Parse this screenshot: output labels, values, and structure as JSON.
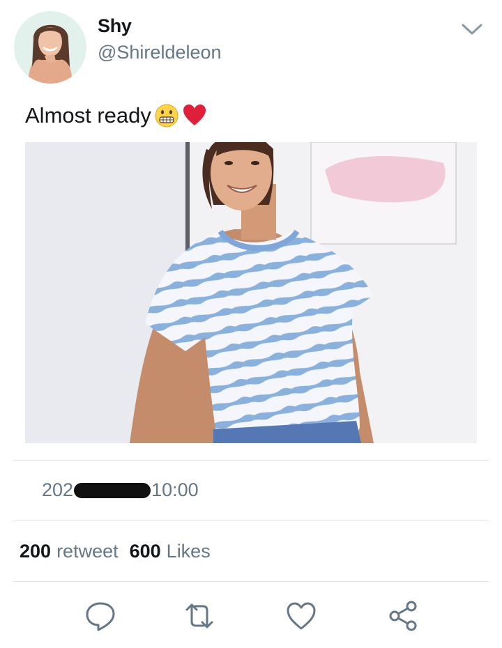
{
  "tweet": {
    "display_name": "Shy",
    "handle": "@Shireldeleon",
    "text": "Almost ready",
    "emojis": [
      "grimacing-face-emoji",
      "red-heart-emoji"
    ],
    "timestamp_prefix": "202",
    "timestamp_suffix": "10:00"
  },
  "stats": {
    "retweet_count": "200",
    "retweet_label": "retweet",
    "likes_count": "600",
    "likes_label": "Likes"
  },
  "icons": {
    "menu": "chevron-down-icon",
    "reply": "reply-icon",
    "retweet": "retweet-icon",
    "like": "heart-icon",
    "share": "share-icon"
  },
  "colors": {
    "secondary_text": "#657786",
    "icon": "#657786",
    "divider": "#dfe3e7",
    "heart": "#e0203a"
  }
}
